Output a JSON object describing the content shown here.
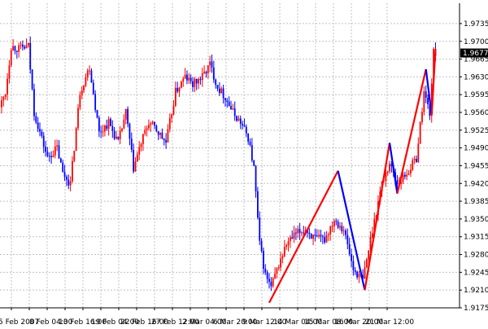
{
  "chart_data": {
    "type": "candlestick",
    "ylim": [
      1.9175,
      1.9775
    ],
    "y_ticks": [
      "1.9735",
      "1.9700",
      "1.9665",
      "1.9630",
      "1.9595",
      "1.9560",
      "1.9525",
      "1.9490",
      "1.9455",
      "1.9420",
      "1.9385",
      "1.9350",
      "1.9315",
      "1.9280",
      "1.9245",
      "1.9210",
      "1.9175"
    ],
    "current_price": "1.9677",
    "x_ticks": [
      "5 Feb 2007",
      "8 Feb 04:00",
      "12 Feb 00:00",
      "13 Feb 16:00",
      "15 Feb 12:00",
      "19 Feb 04:00",
      "20 Feb 20:00",
      "22 Feb 16:00",
      "26 Feb 08:00",
      "27 Feb 12:00",
      "1 Mar 04:00",
      "2 Mar 04:00",
      "5 Mar 08:00",
      "6 Mar 20:00",
      "8 Mar 12:00",
      "9 Mar 12:00",
      "13 Mar 04:00",
      "14 Mar 04:00",
      "15 Mar 08:00",
      "16 Mar 20:00",
      "20 Mar 00:00",
      "21 Mar 12:00"
    ],
    "grid": true,
    "bar_count": 225,
    "bull_color": "#ff0000",
    "bear_color": "#0000ff",
    "zigzag_color": "#ff0000",
    "zigzag_down_color": "#0000ff",
    "zigzag": [
      {
        "bar": 0,
        "price": 1.962
      },
      {
        "bar": 14,
        "price": 1.969
      },
      {
        "bar": 28,
        "price": 1.953
      },
      {
        "bar": 42,
        "price": 1.963
      },
      {
        "bar": 58,
        "price": 1.952
      },
      {
        "bar": 75,
        "price": 1.963
      },
      {
        "bar": 92,
        "price": 1.964
      },
      {
        "bar": 107,
        "price": 1.959
      },
      {
        "bar": 120,
        "price": 1.9455
      },
      {
        "bar": 140,
        "price": 1.9185
      },
      {
        "bar": 176,
        "price": 1.9445
      },
      {
        "bar": 190,
        "price": 1.921
      },
      {
        "bar": 203,
        "price": 1.95
      },
      {
        "bar": 207,
        "price": 1.94
      },
      {
        "bar": 222,
        "price": 1.9645
      },
      {
        "bar": 225,
        "price": 1.9555
      },
      {
        "bar": 227,
        "price": 1.9685
      }
    ],
    "anchors": [
      [
        0,
        1.957
      ],
      [
        3,
        1.96
      ],
      [
        6,
        1.969
      ],
      [
        10,
        1.9685
      ],
      [
        15,
        1.969
      ],
      [
        18,
        1.956
      ],
      [
        25,
        1.947
      ],
      [
        30,
        1.949
      ],
      [
        33,
        1.944
      ],
      [
        37,
        1.942
      ],
      [
        42,
        1.96
      ],
      [
        47,
        1.965
      ],
      [
        52,
        1.952
      ],
      [
        57,
        1.954
      ],
      [
        62,
        1.95
      ],
      [
        66,
        1.956
      ],
      [
        70,
        1.945
      ],
      [
        74,
        1.95
      ],
      [
        78,
        1.954
      ],
      [
        82,
        1.9525
      ],
      [
        87,
        1.95
      ],
      [
        92,
        1.96
      ],
      [
        97,
        1.963
      ],
      [
        101,
        1.9615
      ],
      [
        106,
        1.963
      ],
      [
        110,
        1.9655
      ],
      [
        114,
        1.961
      ],
      [
        118,
        1.959
      ],
      [
        122,
        1.956
      ],
      [
        126,
        1.954
      ],
      [
        130,
        1.951
      ],
      [
        133,
        1.945
      ],
      [
        136,
        1.93
      ],
      [
        139,
        1.924
      ],
      [
        142,
        1.9215
      ],
      [
        146,
        1.926
      ],
      [
        150,
        1.93
      ],
      [
        155,
        1.932
      ],
      [
        160,
        1.933
      ],
      [
        165,
        1.931
      ],
      [
        170,
        1.931
      ],
      [
        175,
        1.935
      ],
      [
        180,
        1.933
      ],
      [
        185,
        1.925
      ],
      [
        190,
        1.923
      ],
      [
        195,
        1.933
      ],
      [
        200,
        1.942
      ],
      [
        204,
        1.946
      ],
      [
        208,
        1.942
      ],
      [
        213,
        1.944
      ],
      [
        218,
        1.947
      ],
      [
        222,
        1.96
      ],
      [
        225,
        1.956
      ],
      [
        227,
        1.9677
      ]
    ]
  }
}
